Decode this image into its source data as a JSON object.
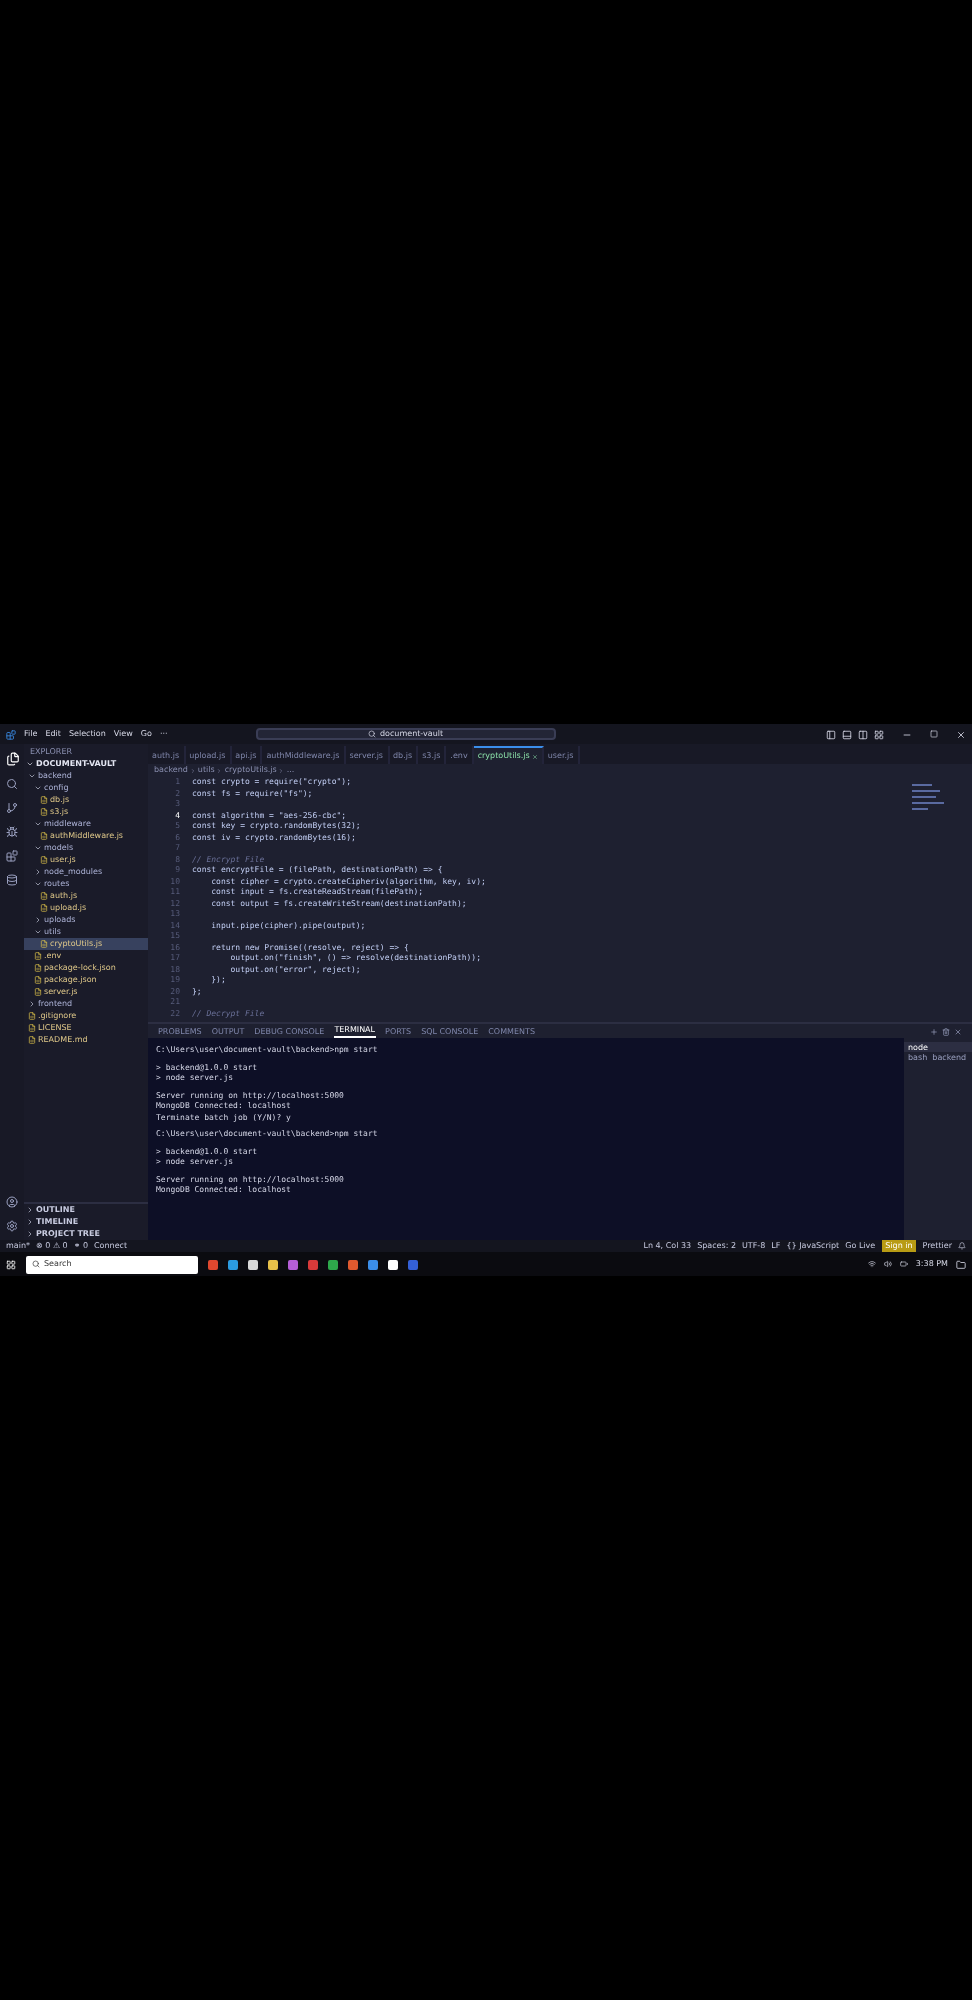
{
  "menu": [
    "File",
    "Edit",
    "Selection",
    "View",
    "Go",
    "···"
  ],
  "search": {
    "value": "document-vault"
  },
  "sidebar": {
    "title": "EXPLORER",
    "root": "DOCUMENT-VAULT",
    "tree": [
      {
        "label": "backend",
        "kind": "folder",
        "expanded": true,
        "selected": false,
        "children": [
          {
            "label": "config",
            "kind": "folder",
            "expanded": true,
            "selected": false,
            "children": [
              {
                "label": "db.js",
                "kind": "file",
                "selected": false
              },
              {
                "label": "s3.js",
                "kind": "file",
                "selected": false
              }
            ]
          },
          {
            "label": "middleware",
            "kind": "folder",
            "expanded": true,
            "selected": false,
            "children": [
              {
                "label": "authMiddleware.js",
                "kind": "file",
                "selected": false
              }
            ]
          },
          {
            "label": "models",
            "kind": "folder",
            "expanded": true,
            "selected": false,
            "children": [
              {
                "label": "user.js",
                "kind": "file",
                "selected": false
              }
            ]
          },
          {
            "label": "node_modules",
            "kind": "folder",
            "expanded": false,
            "selected": false
          },
          {
            "label": "routes",
            "kind": "folder",
            "expanded": true,
            "selected": false,
            "children": [
              {
                "label": "auth.js",
                "kind": "file",
                "selected": false
              },
              {
                "label": "upload.js",
                "kind": "file",
                "selected": false
              }
            ]
          },
          {
            "label": "uploads",
            "kind": "folder",
            "expanded": false,
            "selected": false
          },
          {
            "label": "utils",
            "kind": "folder",
            "expanded": true,
            "selected": false,
            "children": [
              {
                "label": "cryptoUtils.js",
                "kind": "file",
                "selected": true
              }
            ]
          },
          {
            "label": ".env",
            "kind": "file",
            "selected": false
          },
          {
            "label": "package-lock.json",
            "kind": "file",
            "selected": false
          },
          {
            "label": "package.json",
            "kind": "file",
            "selected": false
          },
          {
            "label": "server.js",
            "kind": "file",
            "selected": false
          }
        ]
      },
      {
        "label": "frontend",
        "kind": "folder",
        "expanded": false,
        "selected": false
      },
      {
        "label": ".gitignore",
        "kind": "file",
        "selected": false
      },
      {
        "label": "LICENSE",
        "kind": "file",
        "selected": false
      },
      {
        "label": "README.md",
        "kind": "file",
        "selected": false
      }
    ],
    "sections": [
      "OUTLINE",
      "TIMELINE",
      "PROJECT TREE"
    ]
  },
  "tabs": [
    {
      "label": "auth.js",
      "selected": false
    },
    {
      "label": "upload.js",
      "selected": false
    },
    {
      "label": "api.js",
      "selected": false
    },
    {
      "label": "authMiddleware.js",
      "selected": false
    },
    {
      "label": "server.js",
      "selected": false
    },
    {
      "label": "db.js",
      "selected": false
    },
    {
      "label": "s3.js",
      "selected": false
    },
    {
      "label": ".env",
      "selected": false
    },
    {
      "label": "cryptoUtils.js",
      "selected": true
    },
    {
      "label": "user.js",
      "selected": false
    }
  ],
  "breadcrumb": [
    "backend",
    "utils",
    "cryptoUtils.js",
    "..."
  ],
  "code": [
    {
      "n": "1",
      "kind": "code",
      "text": "const crypto = require(\"crypto\");"
    },
    {
      "n": "2",
      "kind": "code",
      "text": "const fs = require(\"fs\");"
    },
    {
      "n": "3",
      "kind": "blank"
    },
    {
      "n": "4",
      "kind": "code",
      "text": "const algorithm = \"aes-256-cbc\";"
    },
    {
      "n": "5",
      "kind": "code",
      "text": "const key = crypto.randomBytes(32);"
    },
    {
      "n": "6",
      "kind": "code",
      "text": "const iv = crypto.randomBytes(16);"
    },
    {
      "n": "7",
      "kind": "blank"
    },
    {
      "n": "8",
      "kind": "comment",
      "text": "// Encrypt File"
    },
    {
      "n": "9",
      "kind": "code",
      "text": "const encryptFile = (filePath, destinationPath) => {"
    },
    {
      "n": "10",
      "kind": "code",
      "text": "    const cipher = crypto.createCipheriv(algorithm, key, iv);"
    },
    {
      "n": "11",
      "kind": "code",
      "text": "    const input = fs.createReadStream(filePath);"
    },
    {
      "n": "12",
      "kind": "code",
      "text": "    const output = fs.createWriteStream(destinationPath);"
    },
    {
      "n": "13",
      "kind": "blank"
    },
    {
      "n": "14",
      "kind": "code",
      "text": "    input.pipe(cipher).pipe(output);"
    },
    {
      "n": "15",
      "kind": "blank"
    },
    {
      "n": "16",
      "kind": "code",
      "text": "    return new Promise((resolve, reject) => {"
    },
    {
      "n": "17",
      "kind": "code",
      "text": "        output.on(\"finish\", () => resolve(destinationPath));"
    },
    {
      "n": "18",
      "kind": "code",
      "text": "        output.on(\"error\", reject);"
    },
    {
      "n": "19",
      "kind": "code",
      "text": "    });"
    },
    {
      "n": "20",
      "kind": "code",
      "text": "};"
    },
    {
      "n": "21",
      "kind": "blank"
    },
    {
      "n": "22",
      "kind": "comment",
      "text": "// Decrypt File"
    }
  ],
  "panel_tabs": [
    {
      "label": "PROBLEMS",
      "selected": false
    },
    {
      "label": "OUTPUT",
      "selected": false
    },
    {
      "label": "DEBUG CONSOLE",
      "selected": false
    },
    {
      "label": "TERMINAL",
      "selected": true
    },
    {
      "label": "PORTS",
      "selected": false
    },
    {
      "label": "SQL CONSOLE",
      "selected": false
    },
    {
      "label": "COMMENTS",
      "selected": false
    }
  ],
  "terminal": [
    {
      "kind": "text",
      "text": "C:\\Users\\user\\document-vault\\backend>npm start"
    },
    {
      "kind": "blank"
    },
    {
      "kind": "text",
      "text": "> backend@1.0.0 start"
    },
    {
      "kind": "text",
      "text": "> node server.js"
    },
    {
      "kind": "blank"
    },
    {
      "kind": "text",
      "text": "Server running on http://localhost:5000"
    },
    {
      "kind": "text",
      "text": "MongoDB Connected: localhost"
    },
    {
      "kind": "text",
      "text": "Terminate batch job (Y/N)? y"
    },
    {
      "kind": "blank"
    },
    {
      "kind": "text",
      "text": "C:\\Users\\user\\document-vault\\backend>npm start"
    },
    {
      "kind": "blank"
    },
    {
      "kind": "text",
      "text": "> backend@1.0.0 start"
    },
    {
      "kind": "text",
      "text": "> node server.js"
    },
    {
      "kind": "blank"
    },
    {
      "kind": "text",
      "text": "Server running on http://localhost:5000"
    },
    {
      "kind": "text",
      "text": "MongoDB Connected: localhost"
    }
  ],
  "terminals": [
    {
      "label": "node",
      "selected": true
    },
    {
      "label": "bash  backend",
      "selected": false
    }
  ],
  "status_left": [
    "main*",
    "⊗ 0 ⚠ 0",
    "⚭ 0",
    "Connect"
  ],
  "status_right": [
    "Ln 4, Col 33",
    "Spaces: 2",
    "UTF-8",
    "LF",
    "{} JavaScript",
    "Go Live",
    "Sign in",
    "Prettier"
  ],
  "taskbar": {
    "search": "Search",
    "time": "3:38 PM"
  }
}
